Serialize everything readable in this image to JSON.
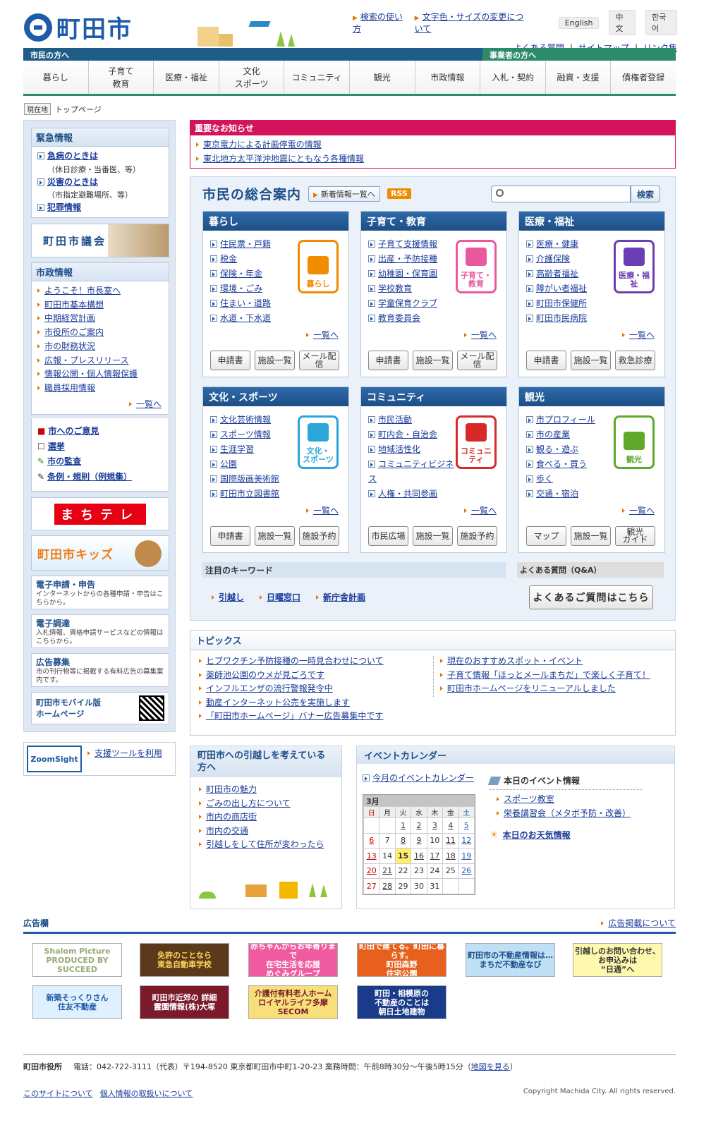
{
  "header": {
    "logo_text": "町田市",
    "links_top": [
      "検索の使い方",
      "文字色・サイズの変更について"
    ],
    "langs": [
      "English",
      "中文",
      "한국어"
    ],
    "links_bottom": [
      "よくある質問",
      "サイトマップ",
      "リンク集"
    ]
  },
  "bar": {
    "left": "市民の方へ",
    "right": "事業者の方へ"
  },
  "gnav": [
    "暮らし",
    "子育て\n教育",
    "医療・福祉",
    "文化\nスポーツ",
    "コミュニティ",
    "観光",
    "市政情報",
    "入札・契約",
    "融資・支援",
    "債権者登録"
  ],
  "breadcrumb": {
    "tag": "現在地",
    "current": "トップページ"
  },
  "left": {
    "emergency": {
      "title": "緊急情報",
      "items": [
        {
          "label": "急病のときは",
          "sub": "（休日診療・当番医、等）"
        },
        {
          "label": "災害のときは",
          "sub": "（市指定避難場所、等）"
        },
        {
          "label": "犯罪情報",
          "sub": ""
        }
      ]
    },
    "council": "町田市議会",
    "shisei": {
      "title": "市政情報",
      "items": [
        "ようこそ！市長室へ",
        "町田市基本構想",
        "中期経営計画",
        "市役所のご案内",
        "市の財務状況",
        "広報・プレスリリース",
        "情報公開・個人情報保護",
        "職員採用情報"
      ],
      "more": "一覧へ"
    },
    "misc": [
      "市へのご意見",
      "選挙",
      "市の監査",
      "条例・規則（例規集）"
    ],
    "machitv": "まちテレ",
    "kids": "町田市キッズ",
    "boxes": [
      {
        "title": "電子申請・申告",
        "desc": "インターネットからの各種申請・申告はこちらから。"
      },
      {
        "title": "電子調達",
        "desc": "入札情報、資格申請サービスなどの情報はこちらから。"
      },
      {
        "title": "広告募集",
        "desc": "市の刊行物等に掲載する有料広告の募集案内です。"
      }
    ],
    "mobile": "町田市モバイル版\nホームページ",
    "zoom": {
      "logo": "ZoomSight",
      "link": "支援ツールを利用"
    }
  },
  "notice": {
    "title": "重要なお知らせ",
    "items": [
      "東京電力による計画停電の情報",
      "東北地方太平洋沖地震にともなう各種情報"
    ]
  },
  "guide": {
    "title": "市民の総合案内",
    "newinfo": "新着情報一覧へ",
    "rss": "RSS",
    "search_btn": "検索",
    "search_placeholder": "",
    "cards": [
      {
        "title": "暮らし",
        "links": [
          "住民票・戸籍",
          "税金",
          "保険・年金",
          "環境・ごみ",
          "住まい・道路",
          "水道・下水道"
        ],
        "icon": "暮らし",
        "icon_name": "house-icon",
        "color": "#f08c00",
        "btns": [
          "申請書",
          "施設一覧",
          "メール配信"
        ]
      },
      {
        "title": "子育て・教育",
        "links": [
          "子育て支援情報",
          "出産・予防接種",
          "幼稚園・保育園",
          "学校教育",
          "学童保育クラブ",
          "教育委員会"
        ],
        "icon": "子育て・\n教育",
        "icon_name": "family-icon",
        "color": "#e85a9c",
        "btns": [
          "申請書",
          "施設一覧",
          "メール配信"
        ]
      },
      {
        "title": "医療・福祉",
        "links": [
          "医療・健康",
          "介護保険",
          "高齢者福祉",
          "障がい者福祉",
          "町田市保健所",
          "町田市民病院"
        ],
        "icon": "医療・福祉",
        "icon_name": "stethoscope-icon",
        "color": "#6a3fb3",
        "btns": [
          "申請書",
          "施設一覧",
          "救急診療"
        ]
      },
      {
        "title": "文化・スポーツ",
        "links": [
          "文化芸術情報",
          "スポーツ情報",
          "生涯学習",
          "公園",
          "国際版画美術館",
          "町田市立図書館"
        ],
        "icon": "文化・\nスポーツ",
        "icon_name": "tennis-racket-icon",
        "color": "#2aa7d8",
        "btns": [
          "申請書",
          "施設一覧",
          "施設予約"
        ]
      },
      {
        "title": "コミュニティ",
        "links": [
          "市民活動",
          "町内会・自治会",
          "地域活性化",
          "コミュニティビジネス",
          "人権・共同参画"
        ],
        "icon": "コミュニティ",
        "icon_name": "people-icon",
        "color": "#d62a2a",
        "btns": [
          "市民広場",
          "施設一覧",
          "施設予約"
        ]
      },
      {
        "title": "観光",
        "links": [
          "市プロフィール",
          "市の産業",
          "観る・遊ぶ",
          "食べる・買う",
          "歩く",
          "交通・宿泊"
        ],
        "icon": "観光",
        "icon_name": "map-icon",
        "color": "#5ea82a",
        "btns": [
          "マップ",
          "施設一覧",
          "観光\nガイド"
        ]
      }
    ],
    "more": "一覧へ",
    "keyword_title": "注目のキーワード",
    "keywords": [
      "引越し",
      "日曜窓口",
      "新庁舎計画"
    ],
    "faq_title": "よくある質問（Q&A）",
    "faq_btn": "よくあるご質問はこちら"
  },
  "topics": {
    "title": "トピックス",
    "left": [
      "ヒブワクチン予防接種の一時見合わせについて",
      "薬師池公園のウメが見ごろです",
      "インフルエンザの流行警報発令中",
      "動産インターネット公売を実施します",
      "「町田市ホームページ」バナー広告募集中です"
    ],
    "right": [
      "現在のおすすめスポット・イベント",
      "子育て情報「ほっとメールまちだ」で楽しく子育て！",
      "町田市ホームページをリニューアルしました"
    ]
  },
  "move": {
    "title": "町田市への引越しを考えている方へ",
    "items": [
      "町田市の魅力",
      "ごみの出し方について",
      "市内の商店街",
      "市内の交通",
      "引越しをして住所が変わったら"
    ]
  },
  "event": {
    "title": "イベントカレンダー",
    "month_link": "今月のイベントカレンダー",
    "month": "3月",
    "dow": [
      "日",
      "月",
      "火",
      "水",
      "木",
      "金",
      "土"
    ],
    "weeks": [
      [
        "",
        "",
        "1",
        "2",
        "3",
        "4",
        "5"
      ],
      [
        "6",
        "7",
        "8",
        "9",
        "10",
        "11",
        "12"
      ],
      [
        "13",
        "14",
        "15",
        "16",
        "17",
        "18",
        "19"
      ],
      [
        "20",
        "21",
        "22",
        "23",
        "24",
        "25",
        "26"
      ],
      [
        "27",
        "28",
        "29",
        "30",
        "31",
        "",
        ""
      ]
    ],
    "today": "15",
    "linked": [
      "1",
      "2",
      "3",
      "4",
      "5",
      "6",
      "8",
      "9",
      "11",
      "12",
      "13",
      "16",
      "17",
      "18",
      "19",
      "20",
      "21",
      "26",
      "28"
    ],
    "today_title": "本日のイベント情報",
    "today_items": [
      "スポーツ教室",
      "栄養講習会（メタボ予防・改善）"
    ],
    "weather": "本日のお天気情報"
  },
  "ads": {
    "title": "広告欄",
    "link": "広告掲載について",
    "items": [
      {
        "text": "Shalom Picture\nPRODUCED BY SUCCEED",
        "bg": "#fff",
        "fg": "#9a7"
      },
      {
        "text": "免許のことなら\n東急自動車学校",
        "bg": "#5a3a1a",
        "fg": "#ffd35a"
      },
      {
        "text": "赤ちゃんからお年寄りまで\n在宅生活を応援\nめぐみグループ",
        "bg": "#f05aa0",
        "fg": "#fff"
      },
      {
        "text": "町田で建てる。町田に暮らす。\n町田森野\n住宅公園",
        "bg": "#e8601e",
        "fg": "#fff"
      },
      {
        "text": "町田市の不動産情報は…\nまちだ不動産なび",
        "bg": "#bfe0f5",
        "fg": "#1e4f8a"
      },
      {
        "text": "引越しのお問い合わせ、\nお申込みは\n“日通”へ",
        "bg": "#fff9b0",
        "fg": "#333"
      },
      {
        "text": "新築そっくりさん\n住友不動産",
        "bg": "#dff0ff",
        "fg": "#1e5ba8"
      },
      {
        "text": "町田市近郊の 詳細\n霊園情報(株)大塚",
        "bg": "#7a1a2a",
        "fg": "#fff"
      },
      {
        "text": "介護付有料老人ホーム\nロイヤルライフ多摩\nSECOM",
        "bg": "#f7e07a",
        "fg": "#7a1a2a"
      },
      {
        "text": "町田・相模原の\n不動産のことは\n朝日土地建物",
        "bg": "#1a3a8a",
        "fg": "#fff"
      }
    ]
  },
  "footer": {
    "org": "町田市役所",
    "info": "電話：042-722-3111（代表）〒194-8520 東京都町田市中町1-20-23 業務時間：午前8時30分〜午後5時15分（",
    "map_link": "地図を見る",
    "close": "）",
    "links": [
      "このサイトについて",
      "個人情報の取扱いについて"
    ],
    "copyright": "Copyright Machida City. All rights reserved."
  }
}
